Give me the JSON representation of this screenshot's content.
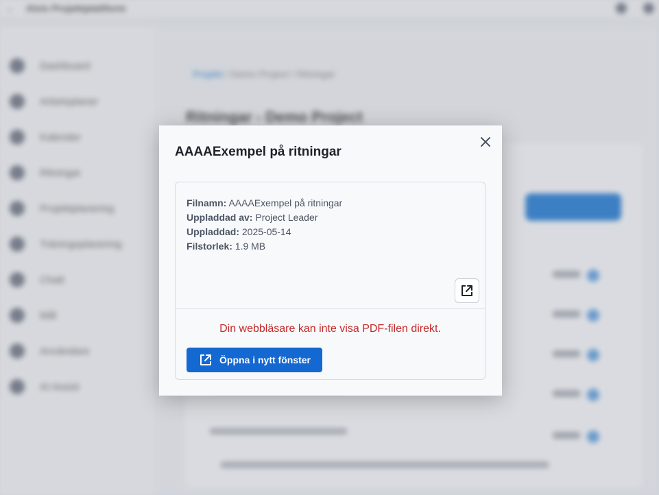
{
  "background": {
    "topbar_title": "Alvis Projektplattform",
    "breadcrumb_link": "Projekt",
    "breadcrumb_rest": " / Demo Project / Ritningar",
    "page_title": "Ritningar - Demo Project",
    "sidebar_items": [
      {
        "label": "Dashboard"
      },
      {
        "label": "Arbetsplaner"
      },
      {
        "label": "Kalender"
      },
      {
        "label": "Ritningar"
      },
      {
        "label": "Projektplanering"
      },
      {
        "label": "Träningsplanering"
      },
      {
        "label": "Chatt"
      },
      {
        "label": "Mål"
      },
      {
        "label": "Användare"
      },
      {
        "label": "AI Assist"
      }
    ]
  },
  "modal": {
    "title": "AAAAExempel på ritningar",
    "fields": [
      {
        "label": "Filnamn:",
        "value": "AAAAExempel på ritningar"
      },
      {
        "label": "Uppladdad av:",
        "value": "Project Leader"
      },
      {
        "label": "Uppladdad:",
        "value": "2025-05-14"
      },
      {
        "label": "Filstorlek:",
        "value": "1.9 MB"
      }
    ],
    "error_text": "Din webbläsare kan inte visa PDF-filen direkt.",
    "open_button_label": "Öppna i nytt fönster",
    "icons": {
      "close": "close-icon",
      "external": "open-external-icon"
    },
    "colors": {
      "primary": "#1468d1",
      "error": "#c62828"
    }
  }
}
